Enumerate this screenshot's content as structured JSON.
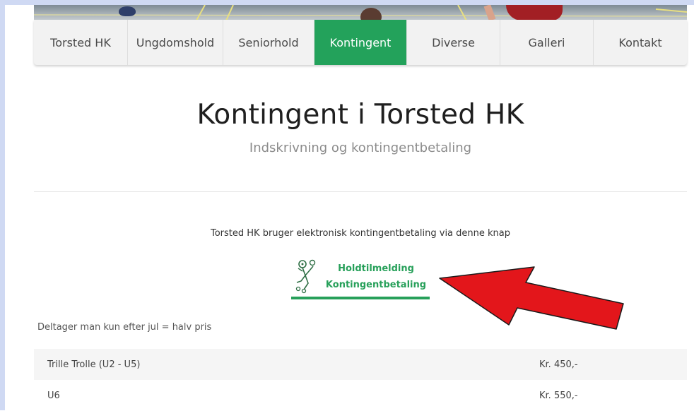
{
  "nav": {
    "items": [
      {
        "label": "Torsted HK",
        "active": false
      },
      {
        "label": "Ungdomshold",
        "active": false
      },
      {
        "label": "Seniorhold",
        "active": false
      },
      {
        "label": "Kontingent",
        "active": true
      },
      {
        "label": "Diverse",
        "active": false
      },
      {
        "label": "Galleri",
        "active": false
      },
      {
        "label": "Kontakt",
        "active": false
      }
    ]
  },
  "page": {
    "title": "Kontingent i Torsted HK",
    "subtitle": "Indskrivning og kontingentbetaling",
    "intro": "Torsted HK bruger elektronisk kontingentbetaling via denne knap",
    "note": "Deltager man kun efter jul = halv pris"
  },
  "payment_button": {
    "line1": "Holdtilmelding",
    "line2": "Kontingentbetaling",
    "icon": "handball-player-icon"
  },
  "price_table": [
    {
      "name": "Trille Trolle (U2 - U5)",
      "price": "Kr. 450,-"
    },
    {
      "name": "U6",
      "price": "Kr. 550,-"
    }
  ],
  "colors": {
    "accent": "#23a25b",
    "arrow": "#e3161b",
    "frame": "#cfd9f3"
  }
}
